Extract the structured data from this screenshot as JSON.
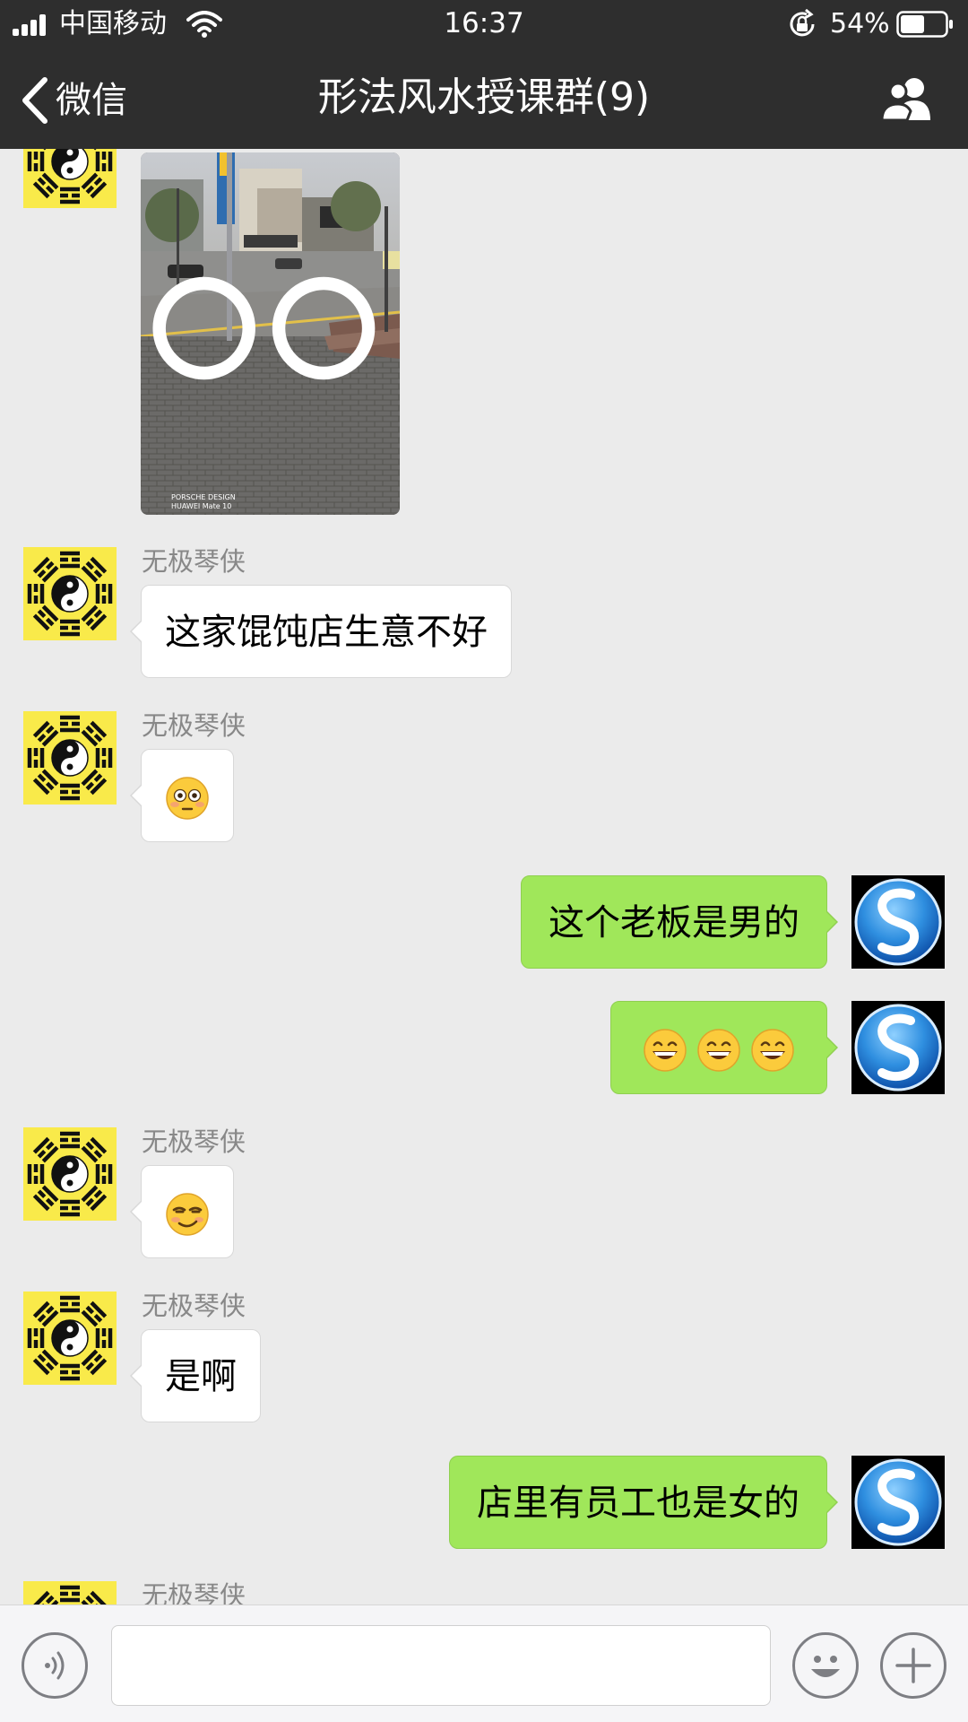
{
  "status_bar": {
    "carrier": "中国移动",
    "time": "16:37",
    "battery_percent": "54%",
    "battery_level": 0.54
  },
  "nav": {
    "back_label": "微信",
    "title": "形法风水授课群(9)",
    "back_icon": "chevron-left-icon",
    "group_icon": "group-members-icon"
  },
  "messages": [
    {
      "type": "image",
      "direction": "in",
      "caption_line1": "PORSCHE DESIGN",
      "caption_line2": "HUAWEI Mate 10"
    },
    {
      "type": "text",
      "direction": "in",
      "sender": "无极琴侠",
      "text": "这家馄饨店生意不好"
    },
    {
      "type": "emoji",
      "direction": "in",
      "sender": "无极琴侠",
      "emoji": "flushed-face-emoji"
    },
    {
      "type": "text",
      "direction": "out",
      "text": "这个老板是男的"
    },
    {
      "type": "emoji",
      "direction": "out",
      "emoji": "grinning-face-emoji",
      "count": 3
    },
    {
      "type": "emoji",
      "direction": "in",
      "sender": "无极琴侠",
      "emoji": "smirking-face-emoji"
    },
    {
      "type": "text",
      "direction": "in",
      "sender": "无极琴侠",
      "text": "是啊"
    },
    {
      "type": "text",
      "direction": "out",
      "text": "店里有员工也是女的"
    },
    {
      "type": "partial",
      "direction": "in",
      "sender": "无极琴侠"
    }
  ],
  "input_bar": {
    "voice_icon": "voice-input-icon",
    "emoji_icon": "emoji-icon",
    "plus_icon": "plus-icon",
    "placeholder": ""
  },
  "colors": {
    "header_bg": "#2e2e2e",
    "chat_bg": "#ebebeb",
    "outgoing_bubble": "#a0e75a",
    "incoming_bubble": "#ffffff",
    "sender_name": "#888888"
  }
}
